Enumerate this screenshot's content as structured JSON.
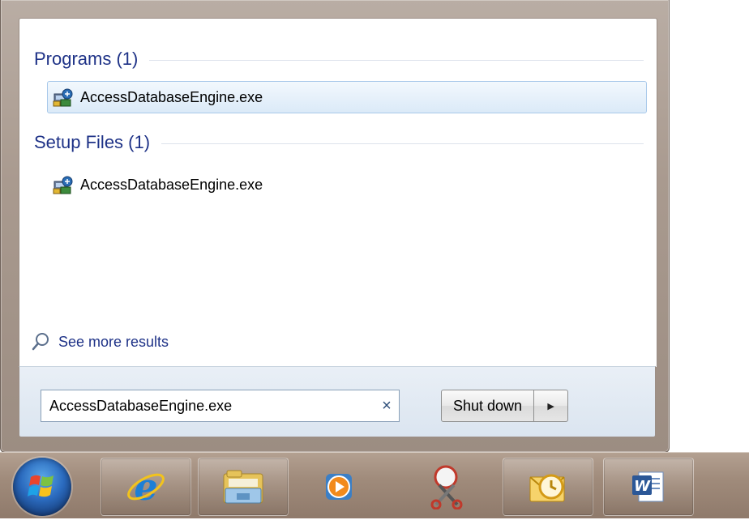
{
  "results": {
    "groups": [
      {
        "header": "Programs (1)",
        "items": [
          "AccessDatabaseEngine.exe"
        ]
      },
      {
        "header": "Setup Files (1)",
        "items": [
          "AccessDatabaseEngine.exe"
        ]
      }
    ],
    "see_more": "See more results"
  },
  "search": {
    "value": "AccessDatabaseEngine.exe",
    "clear_glyph": "×"
  },
  "power": {
    "shutdown_label": "Shut down",
    "arrow_glyph": "▶"
  },
  "taskbar": {
    "items": [
      {
        "icon": "windows-start-orb-icon"
      },
      {
        "icon": "internet-explorer-icon"
      },
      {
        "icon": "windows-explorer-icon"
      },
      {
        "icon": "windows-media-player-icon"
      },
      {
        "icon": "snipping-tool-icon"
      },
      {
        "icon": "outlook-icon"
      },
      {
        "icon": "word-icon"
      }
    ]
  },
  "colors": {
    "group_header": "#1e3287",
    "selection": "#dbeaf8",
    "taskbar": "#a08b7b"
  }
}
